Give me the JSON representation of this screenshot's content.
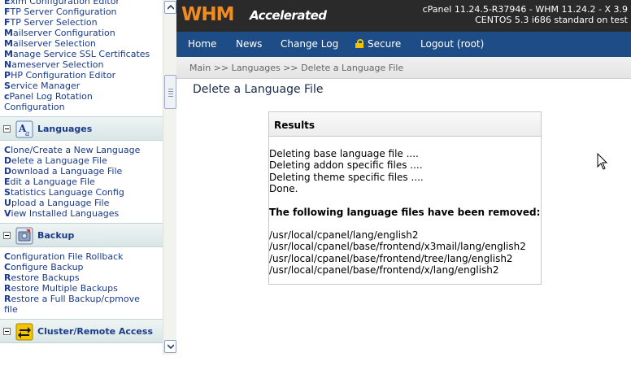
{
  "sidebar": {
    "top_links": [
      {
        "first": "E",
        "rest": "xim Configuration Editor"
      },
      {
        "first": "F",
        "rest": "TP Server Configuration"
      },
      {
        "first": "F",
        "rest": "TP Server Selection"
      },
      {
        "first": "M",
        "rest": "ailserver Configuration"
      },
      {
        "first": "M",
        "rest": "ailserver Selection"
      },
      {
        "first": "M",
        "rest": "anage Service SSL Certificates"
      },
      {
        "first": "N",
        "rest": "ameserver Selection"
      },
      {
        "first": "P",
        "rest": "HP Configuration Editor"
      },
      {
        "first": "S",
        "rest": "ervice Manager"
      },
      {
        "first": "c",
        "rest": "Panel Log Rotation"
      },
      {
        "first": "",
        "rest": "Configuration"
      }
    ],
    "languages": {
      "title": "Languages",
      "links": [
        {
          "first": "C",
          "rest": "lone/Create a New Language"
        },
        {
          "first": "D",
          "rest": "elete a Language File"
        },
        {
          "first": "D",
          "rest": "ownload a Language File"
        },
        {
          "first": "E",
          "rest": "dit a Language File"
        },
        {
          "first": "S",
          "rest": "tatistics Language Config"
        },
        {
          "first": "U",
          "rest": "pload a Language File"
        },
        {
          "first": "V",
          "rest": "iew Installed Languages"
        }
      ]
    },
    "backup": {
      "title": "Backup",
      "links": [
        {
          "first": "C",
          "rest": "onfiguration File Rollback"
        },
        {
          "first": "C",
          "rest": "onfigure Backup"
        },
        {
          "first": "R",
          "rest": "estore Backups"
        },
        {
          "first": "R",
          "rest": "estore Multiple Backups"
        },
        {
          "first": "R",
          "rest": "estore a Full Backup/cpmove"
        },
        {
          "first": "",
          "rest": "file"
        }
      ]
    },
    "cluster": {
      "title": "Cluster/Remote Access"
    }
  },
  "header": {
    "logo_whm": "WHM",
    "logo_accelerated": "Accelerated",
    "version_line1": "cPanel 11.24.5-R37946 - WHM 11.24.2 - X 3.9",
    "version_line2": "CENTOS 5.3 i686 standard on test"
  },
  "nav": {
    "home": "Home",
    "news": "News",
    "changelog": "Change Log",
    "secure": "Secure",
    "logout": "Logout (root)"
  },
  "breadcrumb": "Main >> Languages >> Delete a Language File",
  "page_title": "Delete a Language File",
  "results": {
    "title": "Results",
    "lines": [
      "Deleting base language file ....",
      "Deleting addon specific files ....",
      "Deleting theme specific files ....",
      "Done."
    ],
    "removed_heading": "The following language files have been removed:",
    "files": [
      "/usr/local/cpanel/lang/english2",
      "/usr/local/cpanel/base/frontend/x3mail/lang/english2",
      "/usr/local/cpanel/base/frontend/tree/lang/english2",
      "/usr/local/cpanel/base/frontend/x/lang/english2"
    ]
  },
  "colors": {
    "banner_bg": "#2a2a2a",
    "nav_bg": "#1e4c86",
    "logo_orange": "#f28c1e",
    "link_blue": "#1a3a8a"
  }
}
